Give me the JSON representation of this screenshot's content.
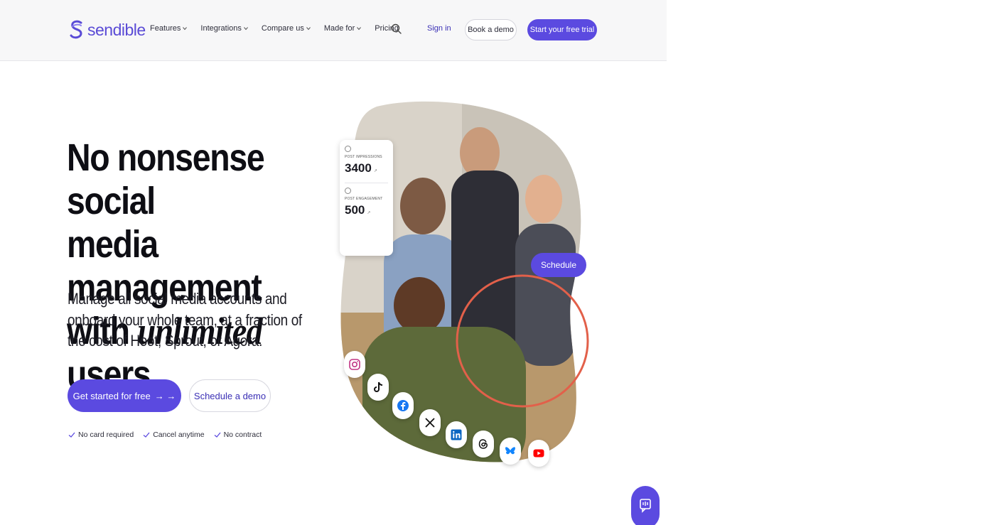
{
  "header": {
    "logo_text": "sendible",
    "nav": [
      {
        "label": "Features",
        "has_dropdown": true
      },
      {
        "label": "Integrations",
        "has_dropdown": true
      },
      {
        "label": "Compare us",
        "has_dropdown": true
      },
      {
        "label": "Made for",
        "has_dropdown": true
      },
      {
        "label": "Pricing",
        "has_dropdown": false
      }
    ],
    "search_icon": "search-icon",
    "sign_in": "Sign in",
    "book_demo": "Book a demo",
    "start_trial": "Start your free trial"
  },
  "hero": {
    "title_line1": "No nonsense social",
    "title_line2": "media management",
    "title_line3_prefix": "with",
    "title_emphasis": "unlimited",
    "title_line3_suffix": "users.",
    "subtitle": "Manage all social media accounts and onboard your whole team, at a fraction of the cost of Hoot, Sprout, or Agora.",
    "primary_cta": "Get started for free",
    "primary_cta_arrow": "→ →",
    "secondary_cta": "Schedule a demo",
    "checks": [
      "No card required",
      "Cancel anytime",
      "No contract"
    ]
  },
  "visual": {
    "stat_card": {
      "impressions_label": "POST IMPRESSIONS",
      "impressions_value": "3400",
      "impressions_trend": "↗",
      "engagement_label": "POST ENGAGEMENT",
      "engagement_value": "500",
      "engagement_trend": "↗"
    },
    "schedule_label": "Schedule",
    "social_icons": [
      "instagram-icon",
      "tiktok-icon",
      "facebook-icon",
      "x-icon",
      "linkedin-icon",
      "threads-icon",
      "bluesky-icon",
      "youtube-icon"
    ]
  },
  "colors": {
    "brand": "#5b4ae0",
    "link": "#3a2fb5",
    "ring": "#e2604a",
    "header_bg": "#f7f7f8"
  },
  "chat_icon": "chat-icon"
}
